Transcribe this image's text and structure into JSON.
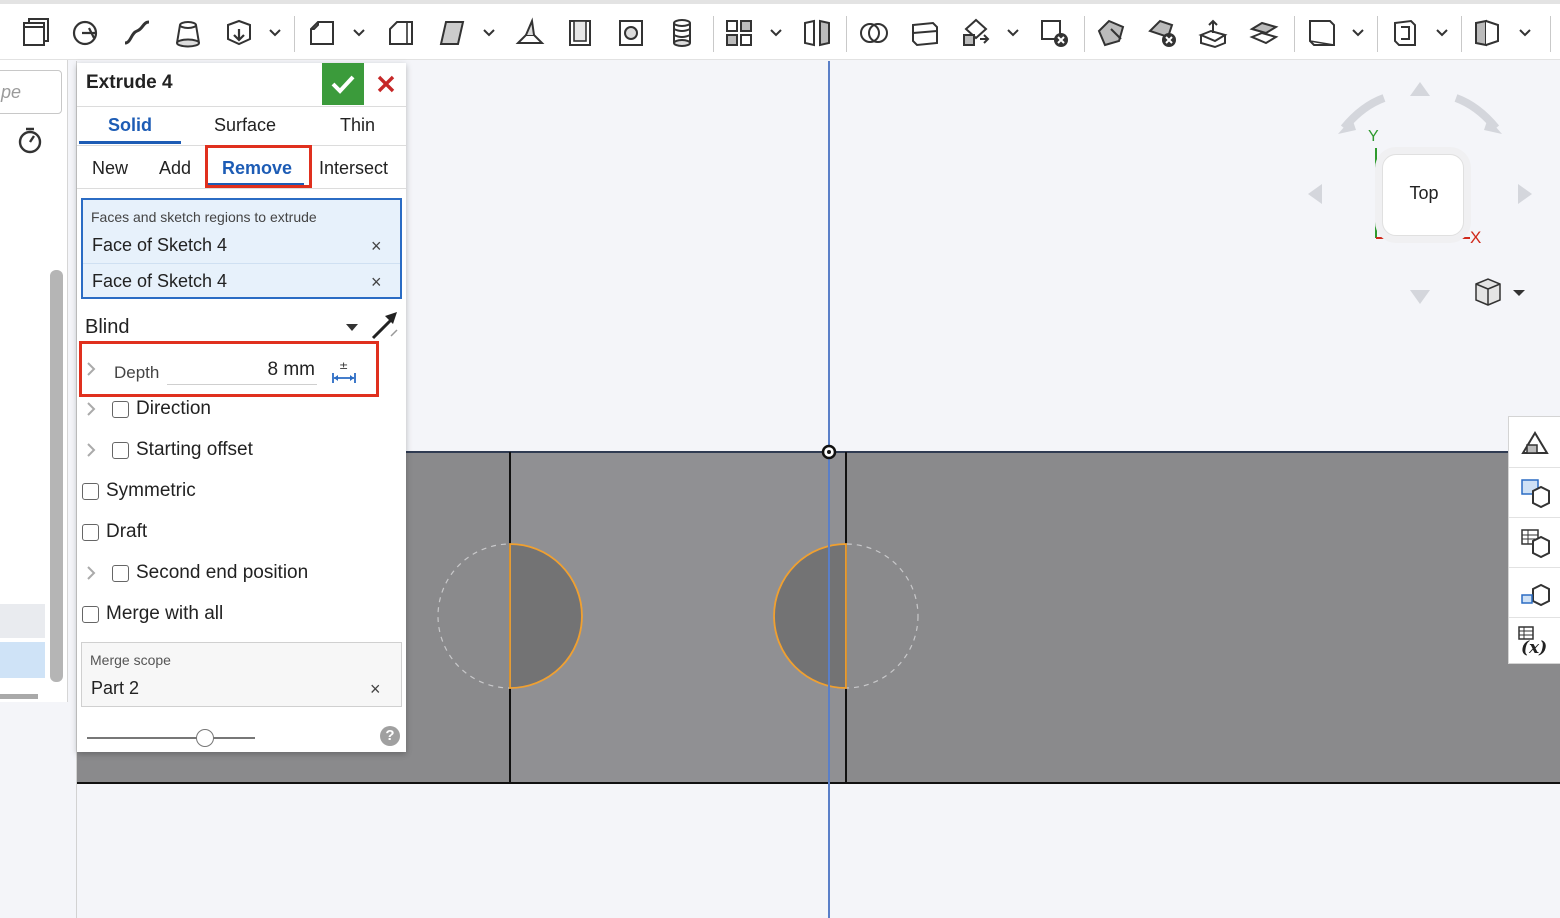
{
  "toolbar": {
    "tools": [
      "new-part-studio-icon",
      "sketch-icon",
      "fillet-curve-icon",
      "extrude-icon",
      "revolve-icon",
      "chamfer-icon",
      "fillet-icon",
      "sweep-icon",
      "loft-icon",
      "shell-icon",
      "hole-icon",
      "thread-icon",
      "pattern-icon",
      "mirror-icon",
      "boolean-icon",
      "split-icon",
      "transform-icon",
      "delete-part-icon",
      "modify-face-icon",
      "delete-face-icon",
      "move-face-icon",
      "replace-face-icon",
      "plane-icon",
      "mate-connector-icon",
      "sheet-metal-icon"
    ]
  },
  "tree": {
    "filter_placeholder": "pe"
  },
  "dialog": {
    "title": "Extrude 4",
    "tabs": [
      "Solid",
      "Surface",
      "Thin"
    ],
    "active_tab": "Solid",
    "operations": [
      "New",
      "Add",
      "Remove",
      "Intersect"
    ],
    "active_operation": "Remove",
    "selection": {
      "label": "Faces and sketch regions to extrude",
      "items": [
        "Face of Sketch 4",
        "Face of Sketch 4"
      ],
      "remove_glyph": "×"
    },
    "end_type": "Blind",
    "depth": {
      "label": "Depth",
      "value": "8 mm",
      "icon_glyph": "±"
    },
    "options": {
      "direction": "Direction",
      "starting_offset": "Starting offset",
      "symmetric": "Symmetric",
      "draft": "Draft",
      "second_end": "Second end position",
      "merge_all": "Merge with all"
    },
    "merge_scope": {
      "label": "Merge scope",
      "item": "Part 2"
    },
    "slider_value": 0.7,
    "help_glyph": "?"
  },
  "viewcube": {
    "face": "Top",
    "axis_y": "Y",
    "axis_x": "X"
  },
  "colors": {
    "accent": "#1d5cb5",
    "ok_green": "#3b9b3b",
    "highlight_red": "#e0301e",
    "part_gray": "#8a8a8c",
    "selection_orange": "#f0a030"
  }
}
